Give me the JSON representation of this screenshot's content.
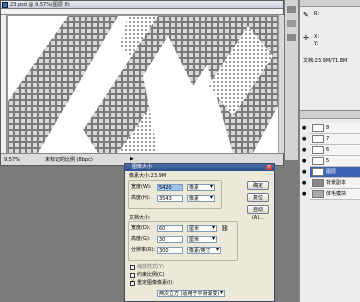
{
  "document": {
    "title": "23.psd @ 9.57%(图层 8)",
    "zoom": "9.57%",
    "status_text": "未标记的比例 (8bpc)"
  },
  "info_panel": {
    "rgb_label": "R:",
    "x_label": "X:",
    "y_label": "Y:",
    "doc_size": "文档:23.9M/71.8M"
  },
  "layers": [
    {
      "label": "8",
      "visible": true
    },
    {
      "label": "7",
      "visible": true
    },
    {
      "label": "6",
      "visible": true
    },
    {
      "label": "5",
      "visible": true
    },
    {
      "label": "图层",
      "visible": true,
      "selected": true
    },
    {
      "label": "背景副本",
      "visible": true
    },
    {
      "label": "体毛模块",
      "visible": true
    }
  ],
  "dialog": {
    "title": "图像大小",
    "pixel_dims": "像素大小:23.9M",
    "width_label": "宽度(W):",
    "width_value": "5420",
    "height_label": "高度(H):",
    "height_value": "3543",
    "pixel_unit": "像素",
    "doc_size_label": "文档大小:",
    "doc_width_label": "宽度(D):",
    "doc_width_value": "60",
    "doc_height_label": "高度(G):",
    "doc_height_value": "30",
    "cm_unit": "厘米",
    "res_label": "分辨率(R):",
    "res_value": "300",
    "res_unit": "像素/英寸",
    "ok": "确定",
    "reset": "复位",
    "auto": "自动(A)...",
    "scale_styles": "缩放样式(Y)",
    "constrain": "约束比例(C)",
    "resample": "重定图像像素(I):",
    "resample_method": "两次立方 (适用于平滑渐变)"
  }
}
